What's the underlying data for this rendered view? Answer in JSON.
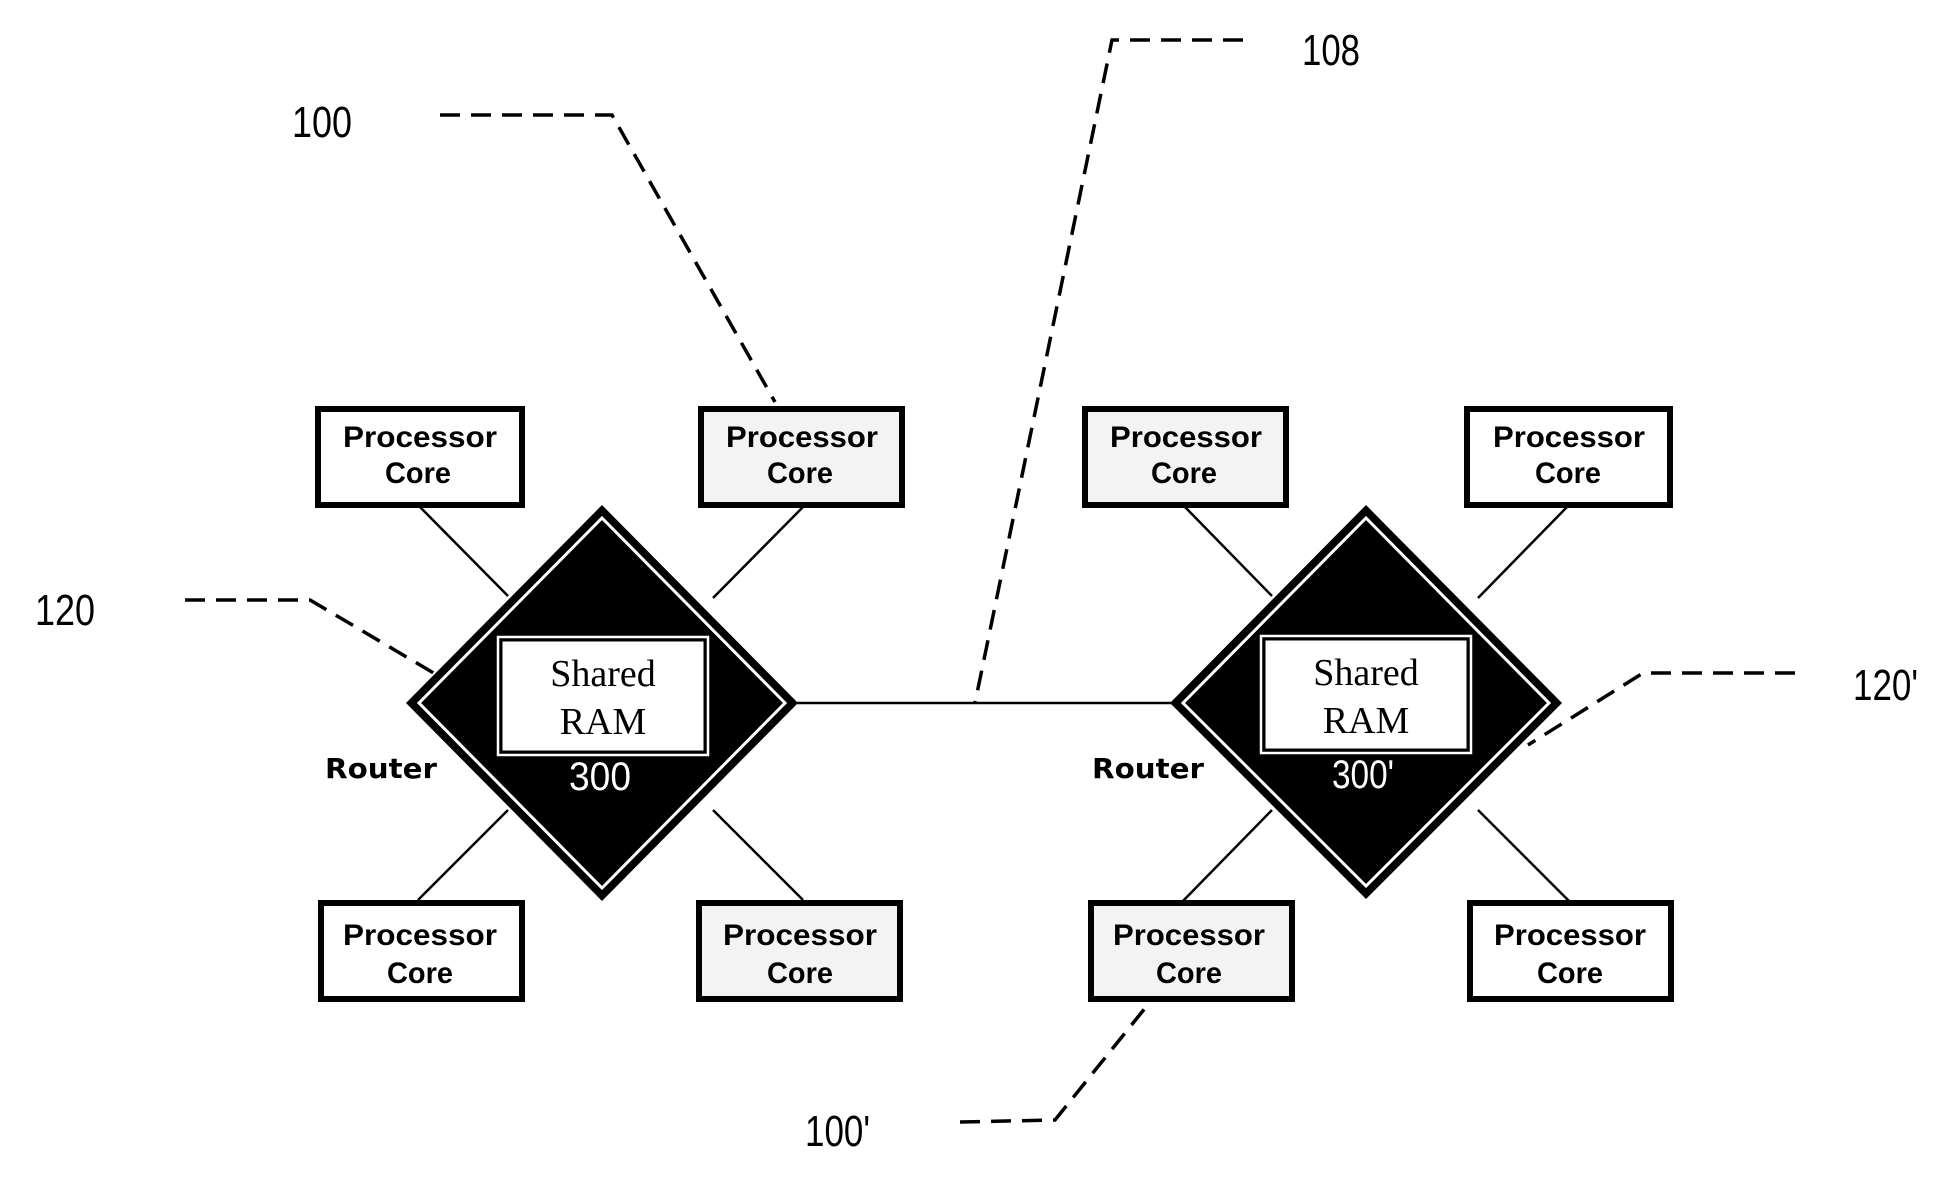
{
  "figure": {
    "reference_labels": {
      "node_left": "100",
      "node_right": "100'",
      "interconnect": "108",
      "router_left": "120",
      "router_right": "120'"
    },
    "nodes": [
      {
        "router": {
          "label": "Router",
          "number": "300",
          "memory_line1": "Shared",
          "memory_line2": "RAM"
        },
        "cores": [
          {
            "line1": "Processor",
            "line2": "Core"
          },
          {
            "line1": "Processor",
            "line2": "Core"
          },
          {
            "line1": "Processor",
            "line2": "Core"
          },
          {
            "line1": "Processor",
            "line2": "Core"
          }
        ]
      },
      {
        "router": {
          "label": "Router",
          "number": "300'",
          "memory_line1": "Shared",
          "memory_line2": "RAM"
        },
        "cores": [
          {
            "line1": "Processor",
            "line2": "Core"
          },
          {
            "line1": "Processor",
            "line2": "Core"
          },
          {
            "line1": "Processor",
            "line2": "Core"
          },
          {
            "line1": "Processor",
            "line2": "Core"
          }
        ]
      }
    ]
  }
}
